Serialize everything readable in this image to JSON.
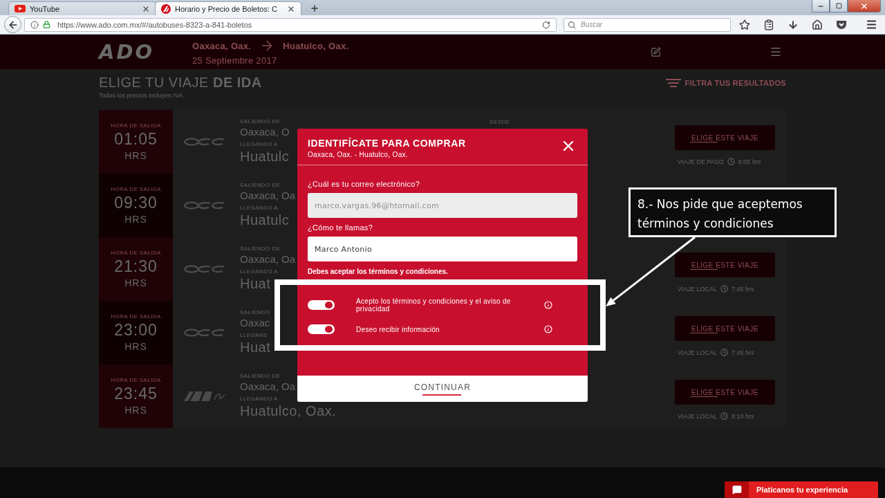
{
  "browser": {
    "tabs": [
      {
        "title": "YouTube",
        "kind": "youtube",
        "selected": false
      },
      {
        "title": "Horario y Precio de Boletos: C",
        "kind": "ado",
        "selected": true
      }
    ],
    "url": "https://www.ado.com.mx/#/autobuses-8323-a-841-boletos",
    "search": {
      "placeholder": "Buscar"
    }
  },
  "header": {
    "logo": "ADO",
    "origin": "Oaxaca, Oax.",
    "destination": "Huatulco, Oax.",
    "date": "25 Septiembre 2017"
  },
  "results": {
    "title": "ELIGE TU VIAJE **DE IDA**",
    "subtitle": "Todos los precios incluyen IVA",
    "filter": "FILTRA TUS RESULTADOS"
  },
  "trips": [
    {
      "time_label": "HORA DE SALIDA",
      "time": "01:05",
      "unit": "HRS",
      "kind": "occ",
      "from_label": "SALIENDO DE",
      "from": "Oaxaca, O",
      "to_label": "LLEGANDO A",
      "to": "Huatulc",
      "price_label": "DESDE",
      "button": "ELIGE ESTE VIAJE",
      "trip_type": "VIAJE DE PASO",
      "duration": "6:05 hrs"
    },
    {
      "time_label": "HORA DE SALIDA",
      "time": "09:30",
      "unit": "HRS",
      "kind": "occ",
      "from_label": "SALIENDO DE",
      "from": "Oaxaca, Oa",
      "to_label": "LLEGANDO A",
      "to": "Huatulc"
    },
    {
      "time_label": "HORA DE SALIDA",
      "time": "21:30",
      "unit": "HRS",
      "kind": "occ",
      "from_label": "SALIENDO DE",
      "from": "Oaxaca, Oa",
      "to_label": "LLEGANDO A",
      "to": "Huat",
      "button": "ELIGE ESTE VIAJE",
      "trip_type": "VIAJE LOCAL",
      "duration": "7:45 hrs"
    },
    {
      "time_label": "HORA DE SALIDA",
      "time": "23:00",
      "unit": "HRS",
      "kind": "occ",
      "from_label": "SALIENDO",
      "from": "Oaxac",
      "to_label": "LLEGAND",
      "to": "Huat",
      "button": "ELIGE ESTE VIAJE",
      "trip_type": "VIAJE LOCAL",
      "duration": "7:45 hrs"
    },
    {
      "time_label": "HORA DE SALIDA",
      "time": "23:45",
      "unit": "HRS",
      "kind": "ado",
      "from_label": "SALIENDO DE",
      "from": "Oaxaca, Oa",
      "to_label": "LLEGANDO A",
      "to": "Huatulco, Oax.",
      "button": "ELIGE ESTE VIAJE",
      "trip_type": "VIAJE LOCAL",
      "duration": "8:10 hrs"
    }
  ],
  "modal": {
    "title": "IDENTIFÍCATE PARA COMPRAR",
    "subtitle": "Oaxaca, Oax. - Huatulco, Oax.",
    "fields": [
      {
        "label": "¿Cuál es tu correo electrónico?",
        "value": "marco.vargas.96@htomail.com",
        "disabled": true
      },
      {
        "label": "¿Cómo te llamas?",
        "value": "Marco Antonio",
        "disabled": false
      }
    ],
    "error": "Debes aceptar los términos y condiciones.",
    "toggles": [
      {
        "label": "Acepto los términos y condiciones y el aviso de privacidad",
        "on": true
      },
      {
        "label": "Deseo recibir información",
        "on": true
      }
    ],
    "button": "CONTINUAR"
  },
  "annotation": {
    "text": "8.- Nos pide que aceptemos términos y condiciones"
  },
  "feedback": {
    "label": "Platicanos tu experiencia"
  }
}
